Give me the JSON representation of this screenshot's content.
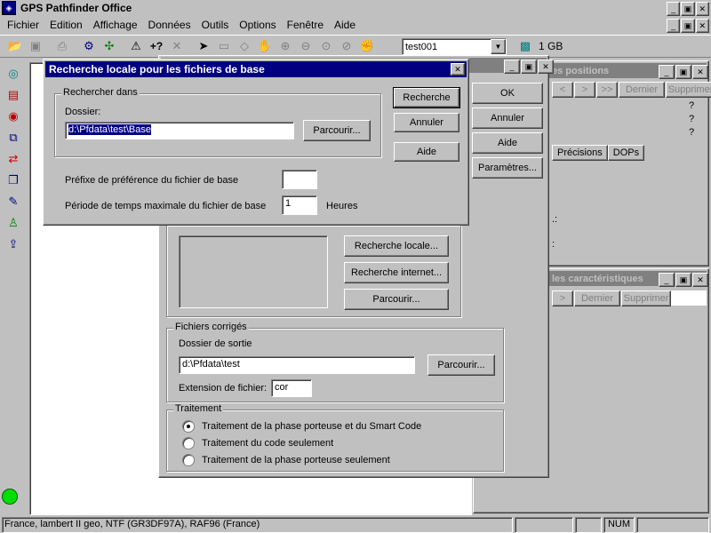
{
  "app": {
    "title": "GPS Pathfinder Office",
    "menu": [
      "Fichier",
      "Edition",
      "Affichage",
      "Données",
      "Outils",
      "Options",
      "Fenêtre",
      "Aide"
    ],
    "window_controls": [
      "_",
      "▣",
      "✕"
    ]
  },
  "toolbar": {
    "project_value": "test001",
    "size_label": "1 GB"
  },
  "positions_window": {
    "title": "es positions",
    "nav": [
      "<",
      ">",
      ">>"
    ],
    "last_label": "Dernier",
    "delete_label": "Supprimer",
    "q_marks": [
      "?",
      "?",
      "?"
    ],
    "tabs": [
      "Précisions",
      "DOPs"
    ],
    "colon_marks": [
      ".:",
      ":"
    ]
  },
  "features_window": {
    "title": "les caractéristiques",
    "nav": [
      ">"
    ],
    "last_label": "Dernier",
    "delete_label": "Supprimer"
  },
  "diff_dialog": {
    "ok_label": "OK",
    "cancel_label": "Annuler",
    "help_label": "Aide",
    "params_label": "Paramètres...",
    "local_search_label": "Recherche locale...",
    "internet_search_label": "Recherche internet...",
    "browse_label": "Parcourir...",
    "corrected_group": "Fichiers corrigés",
    "output_folder_label": "Dossier de sortie",
    "output_folder_value": "d:\\Pfdata\\test",
    "output_browse_label": "Parcourir...",
    "ext_label": "Extension de fichier:",
    "ext_value": "cor",
    "processing_group": "Traitement",
    "options": [
      "Traitement de la phase porteuse et du Smart Code",
      "Traitement du code seulement",
      "Traitement de la phase porteuse seulement"
    ]
  },
  "search_dialog": {
    "title": "Recherche locale pour les fichiers de base",
    "group_label": "Rechercher dans",
    "folder_label": "Dossier:",
    "folder_value": "d:\\Pfdata\\test\\Base",
    "browse_label": "Parcourir...",
    "search_label": "Recherche",
    "cancel_label": "Annuler",
    "help_label": "Aide",
    "prefix_label": "Préfixe de préférence du fichier de base",
    "prefix_value": "",
    "period_label": "Période de temps maximale du fichier de base",
    "period_value": "1",
    "period_unit": "Heures"
  },
  "statusbar": {
    "text": "France, lambert II geo, NTF (GR3DF97A), RAF96 (France)",
    "num_label": "NUM"
  }
}
